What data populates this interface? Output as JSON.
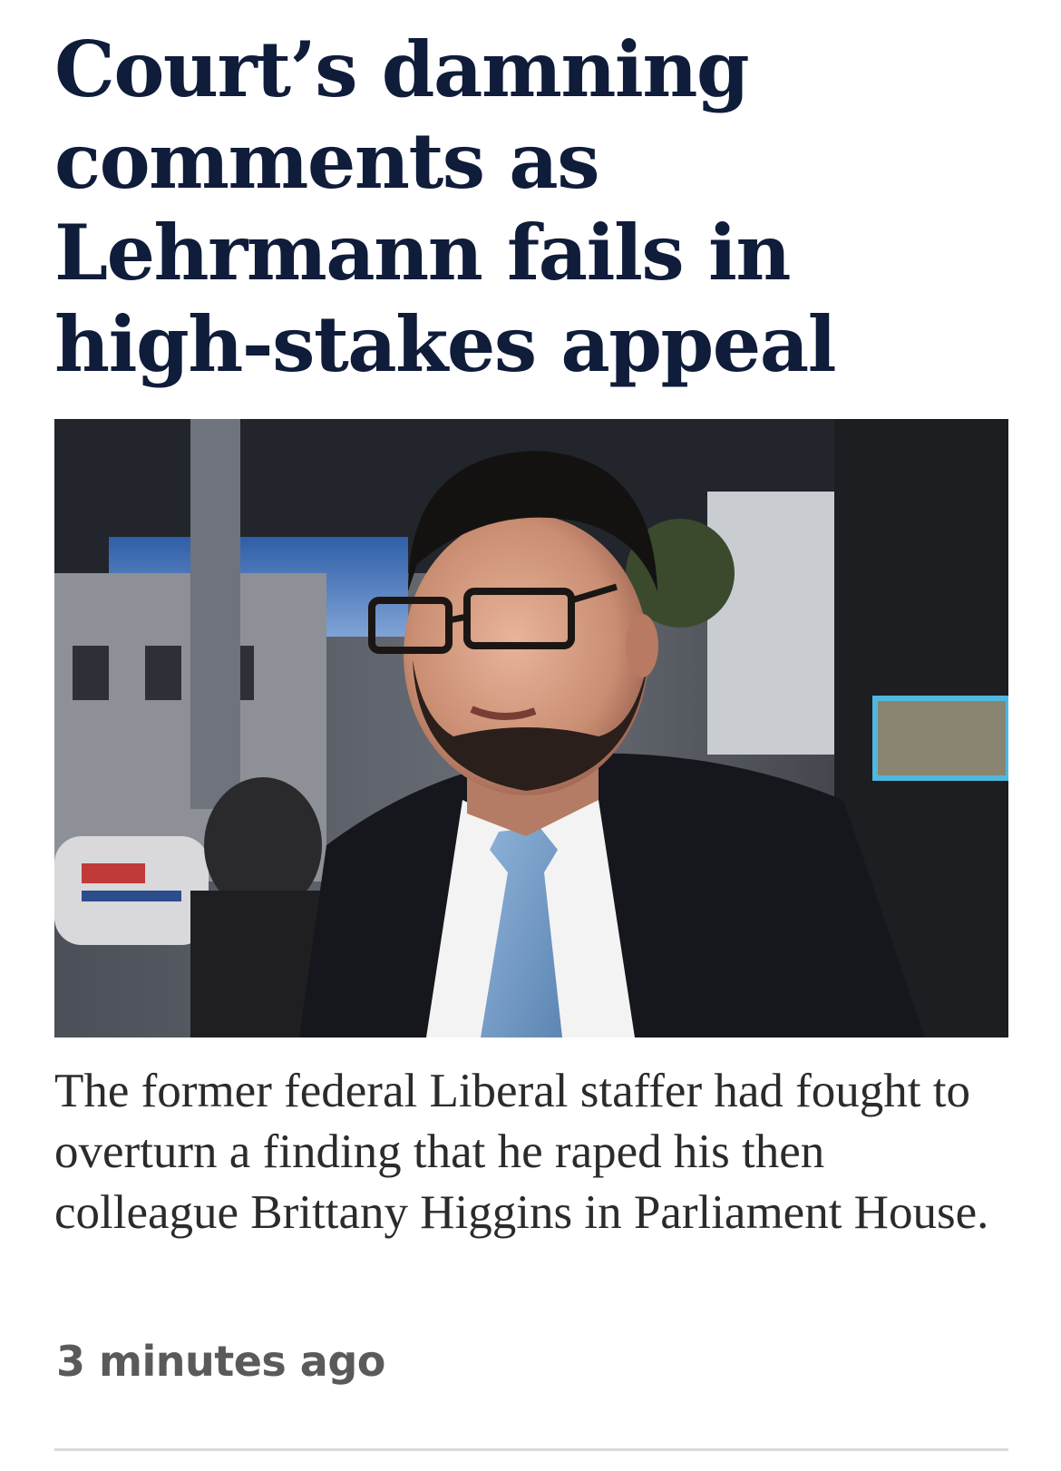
{
  "article": {
    "headline": "Court’s damning comments as Lehrmann fails in high-stakes appeal",
    "image_alt": "Man in glasses, dark suit, white shirt and blue tie outside a building",
    "standfirst": "The former federal Liberal staffer had fought to overturn a finding that he raped his then colleague Brittany Higgins in Parliament House.",
    "timestamp": "3 minutes ago"
  },
  "colors": {
    "headline": "#0f1c3a",
    "body_text": "#2b2b2b",
    "timestamp": "#5a5a5a",
    "divider": "#d6dbe0"
  }
}
